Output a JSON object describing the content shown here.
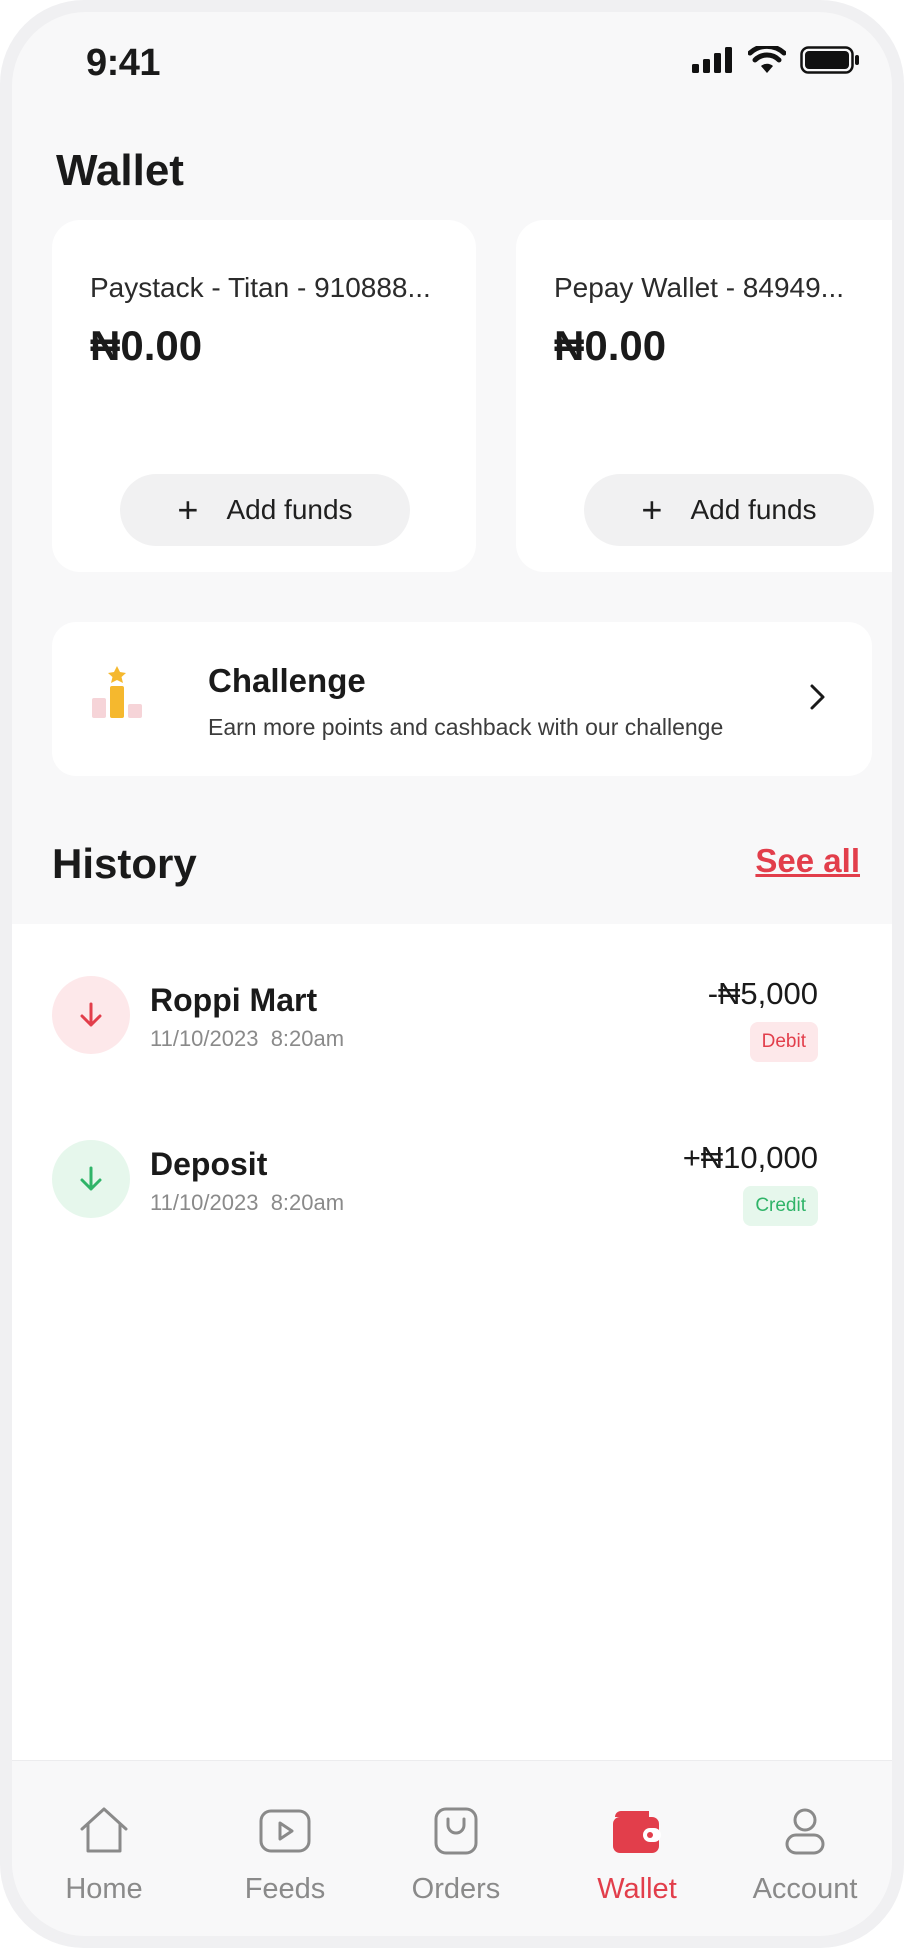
{
  "status_bar": {
    "time": "9:41"
  },
  "page_title": "Wallet",
  "wallets": [
    {
      "title": "Paystack - Titan - 910888...",
      "balance": "₦0.00",
      "add_funds_label": "Add funds"
    },
    {
      "title": "Pepay Wallet - 84949...",
      "balance": "₦0.00",
      "add_funds_label": "Add funds"
    }
  ],
  "challenge": {
    "title": "Challenge",
    "subtitle": "Earn more points and cashback with our challenge"
  },
  "history": {
    "title": "History",
    "see_all_label": "See all",
    "items": [
      {
        "name": "Roppi Mart",
        "date": "11/10/2023  8:20am",
        "amount": "-₦5,000",
        "type": "Debit"
      },
      {
        "name": "Deposit",
        "date": "11/10/2023  8:20am",
        "amount": "+₦10,000",
        "type": "Credit"
      }
    ]
  },
  "nav": {
    "items": [
      {
        "label": "Home",
        "icon": "home-icon"
      },
      {
        "label": "Feeds",
        "icon": "play-icon"
      },
      {
        "label": "Orders",
        "icon": "shopping-bag-icon"
      },
      {
        "label": "Wallet",
        "icon": "wallet-icon",
        "active": true
      },
      {
        "label": "Account",
        "icon": "user-icon"
      }
    ]
  },
  "colors": {
    "accent": "#e23e4b",
    "debit_bg": "#fde8ea",
    "credit": "#2fb468",
    "credit_bg": "#e6f7ec",
    "trophy_gold": "#f5b82e"
  }
}
